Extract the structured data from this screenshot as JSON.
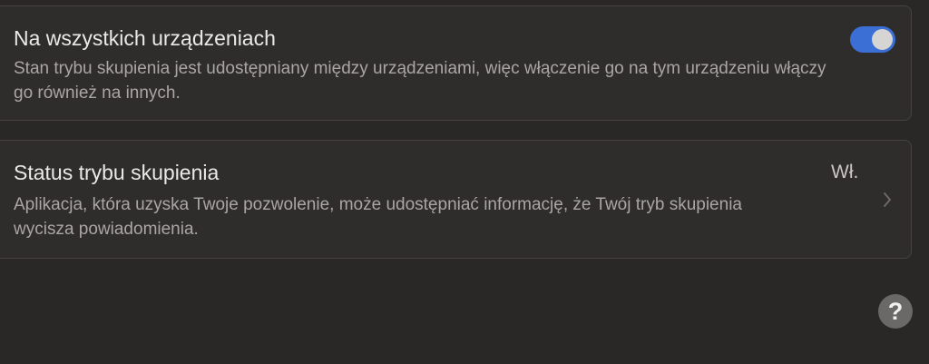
{
  "shared_across_devices": {
    "title": "Na wszystkich urządzeniach",
    "description": "Stan trybu skupienia jest udostępniany między urządzeniami, więc włączenie go na tym urządzeniu włączy go również na innych.",
    "toggle_on": true,
    "toggle_color": "#3b6fd6"
  },
  "focus_status": {
    "title": "Status trybu skupienia",
    "value": "Wł.",
    "description": "Aplikacja, która uzyska Twoje pozwolenie, może udostępniać informację, że Twój tryb skupienia wycisza powiadomienia.",
    "icon": "chevron-right-icon"
  },
  "help": {
    "label": "?",
    "icon": "help-icon"
  }
}
